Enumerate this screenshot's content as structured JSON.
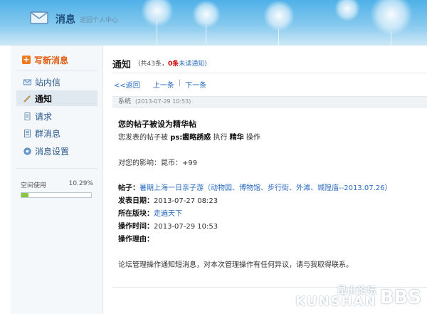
{
  "header": {
    "title": "消息",
    "subtitle": "返回个人中心"
  },
  "sidebar": {
    "compose_label": "写新消息",
    "items": [
      {
        "label": "站内信",
        "icon": "envelope-icon"
      },
      {
        "label": "通知",
        "icon": "pencil-icon",
        "active": true
      },
      {
        "label": "请求",
        "icon": "document-icon"
      },
      {
        "label": "群消息",
        "icon": "group-doc-icon"
      },
      {
        "label": "消息设置",
        "icon": "settings-icon"
      }
    ],
    "space": {
      "label": "空间使用",
      "percent_text": "10.29%",
      "fraction": 0.1029
    }
  },
  "content": {
    "title": "通知",
    "count_prefix": "(共43条，",
    "unread": "0条",
    "unread_suffix": "未读通知)",
    "pager": {
      "back": "<<返回",
      "prev": "上一条",
      "sep": "|",
      "next": "下一条"
    },
    "message": {
      "sender": "系统",
      "date": "(2013-07-29 10:53)",
      "headline": "您的帖子被设为精华帖",
      "l1_pre": "您发表的帖子被",
      "l1_user": "ps:鑑略誘惑",
      "l1_mid": "执行",
      "l1_action": "精华",
      "l1_post": "操作",
      "impact": "对您的影响：昆币：+99",
      "post_label": "帖子：",
      "post_link": "暑期上海一日亲子游（动物园、博物馆、步行街、外滩、城隍庙--2013.07.26）",
      "publish_label": "发表日期：",
      "publish_value": "2013-07-27 08:23",
      "board_label": "所在版块：",
      "board_link": "走遍天下",
      "op_time_label": "操作时间：",
      "op_time_value": "2013-07-29 10:53",
      "reason_label": "操作理由：",
      "footer": "论坛管理操作通知短消息，对本次管理操作有任何异议，请与我取得联系。"
    }
  },
  "watermark": {
    "cn": "昆山论坛",
    "en": "KUNSHAN",
    "bbs": "BBS"
  },
  "colors": {
    "accent": "#2a6bbf",
    "compose": "#e35d13",
    "bar": "#8cc63f"
  }
}
